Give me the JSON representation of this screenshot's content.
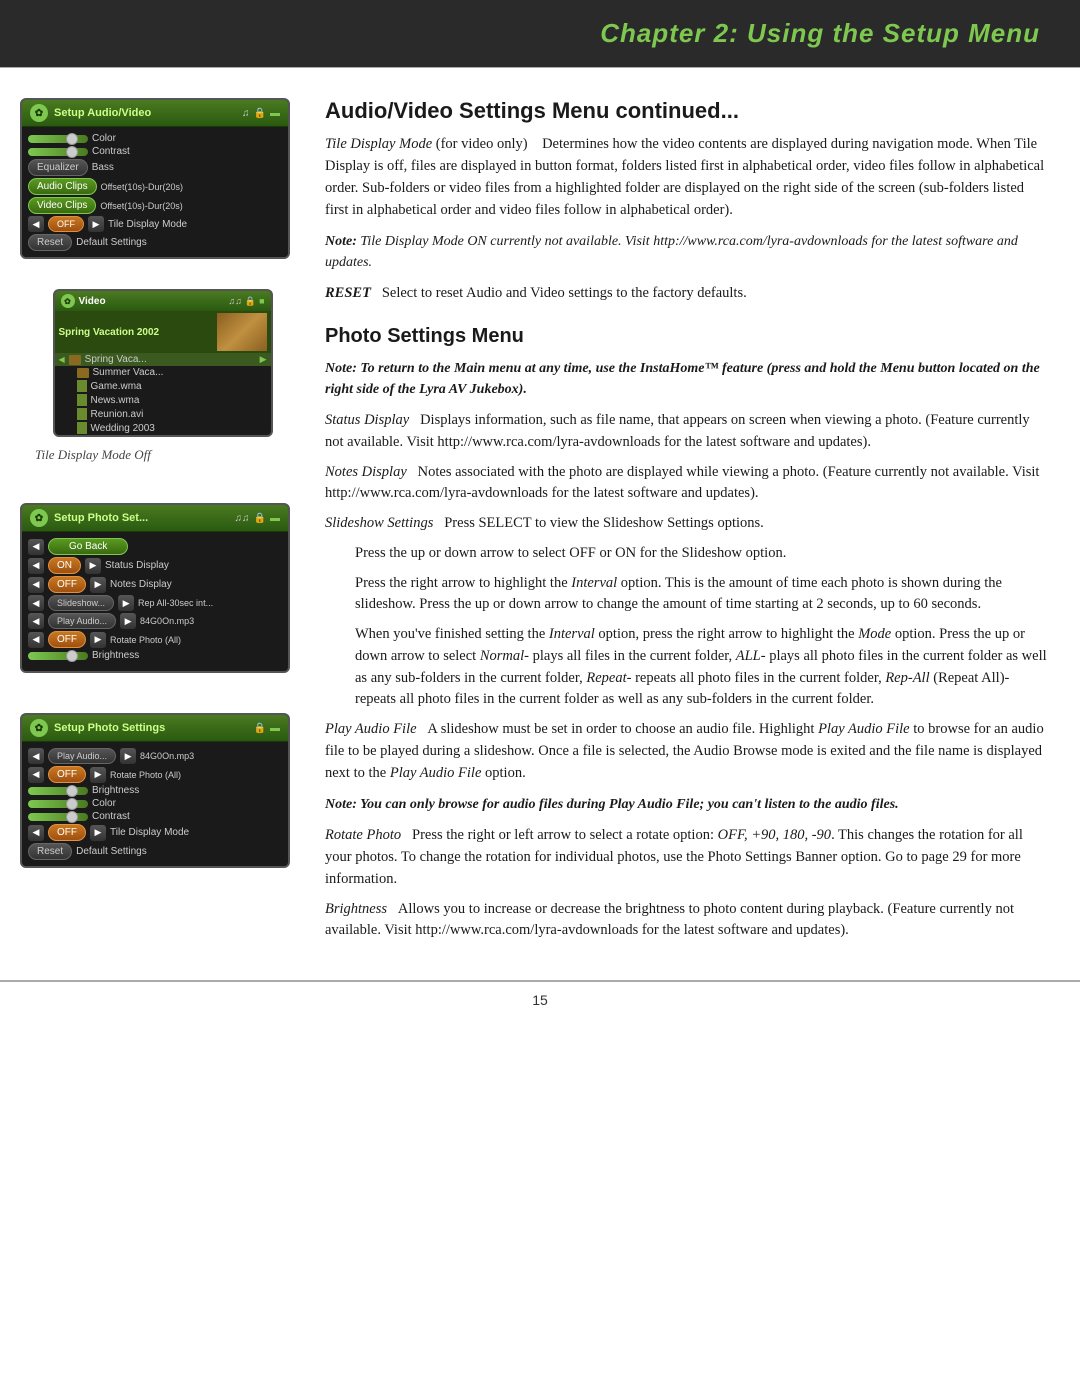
{
  "header": {
    "chapter": "Chapter 2: ",
    "title": "Using the Setup Menu"
  },
  "section1": {
    "title": "Audio/Video Settings Menu continued...",
    "intro": "Tile Display Mode (for video only)    Determines how the video contents are displayed during navigation mode. When Tile Display is off, files are displayed in button format, folders listed first in alphabetical order, video files follow in alphabetical order. Sub-folders or video files from a highlighted folder are displayed on the right side of the screen (sub-folders listed first in alphabetical order and video files follow in alphabetical order).",
    "note": "Note: Tile Display Mode ON currently not available. Visit http://www.rca.com/lyra-avdownloads for the latest software and updates.",
    "video_caption": "Tile Display Mode Off",
    "reset_text": "RESET    Select to reset Audio and Video settings to the factory defaults."
  },
  "section2": {
    "title": "Photo Settings Menu",
    "note1": "Note: To return to the Main menu at any time, use the InstaHome™ feature (press and hold the Menu button located on the right side of the Lyra AV Jukebox).",
    "status_display": "Status Display    Displays information, such as file name, that appears on screen when viewing a photo. (Feature currently not available. Visit http://www.rca.com/lyra-avdownloads for the latest software and updates).",
    "notes_display": "Notes Display    Notes associated with the photo are displayed while viewing a photo. (Feature currently not available. Visit http://www.rca.com/lyra-avdownloads for the latest software and updates).",
    "slideshow_settings_label": "Slideshow Settings",
    "slideshow_settings_text": "Press SELECT to view the Slideshow Settings options.",
    "slideshow_p1": "Press the up or down arrow to select OFF or ON for the Slideshow option.",
    "slideshow_p2": "Press the right arrow to highlight the Interval option. This is the amount of time each photo is shown during the slideshow. Press the up or down arrow to change the amount of time starting at 2 seconds, up to 60 seconds.",
    "slideshow_p3": "When you've finished setting the Interval option, press the right arrow to highlight the Mode option. Press the up or down arrow to select Normal- plays all files in the current folder, ALL- plays all photo files in the current folder as well as any sub-folders in the current folder, Repeat- repeats all photo files in the current folder, Rep-All (Repeat All)- repeats all photo files in the current folder as well as any sub-folders in the current folder.",
    "play_audio": "Play Audio File    A slideshow must be set in order to choose an audio file. Highlight Play Audio File to browse for an audio file to be played during a slideshow. Once a file is selected, the Audio Browse mode is exited and the file name is displayed next to the Play Audio File option.",
    "note2": "Note: You can only browse for audio files during Play Audio File; you can't listen to the audio files.",
    "rotate_photo": "Rotate Photo    Press the right or left arrow to select a rotate option: OFF, +90, 180, -90. This changes the rotation for all your photos. To change the rotation for individual photos, use the Photo Settings Banner option. Go to page 29 for more information.",
    "brightness": "Brightness    Allows you to increase or decrease the brightness to photo content during playback. (Feature currently not available. Visit http://www.rca.com/lyra-avdownloads for the latest software and updates)."
  },
  "device1": {
    "title": "Setup",
    "subtitle": "Audio/Video",
    "rows": [
      {
        "type": "slider",
        "label": "Color"
      },
      {
        "type": "slider",
        "label": "Contrast"
      },
      {
        "type": "labeled",
        "key": "Equalizer",
        "value": "Bass"
      },
      {
        "type": "labeled",
        "key": "Audio Clips",
        "value": "Offset(10s)-Dur(20s)"
      },
      {
        "type": "labeled",
        "key": "Video Clips",
        "value": "Offset(10s)-Dur(20s)"
      },
      {
        "type": "arrow-value",
        "value": "OFF",
        "label": "Tile Display Mode"
      },
      {
        "type": "labeled",
        "key": "Reset",
        "value": "Default Settings"
      }
    ]
  },
  "device2": {
    "title": "Setup",
    "subtitle": "Photo Set...",
    "rows": [
      {
        "type": "back",
        "label": "Go Back"
      },
      {
        "type": "arrow-value",
        "value": "ON",
        "label": "Status Display"
      },
      {
        "type": "arrow-value",
        "value": "OFF",
        "label": "Notes Display"
      },
      {
        "type": "arrow-value",
        "value": "Slideshow...",
        "label": "Rep All-30sec int..."
      },
      {
        "type": "arrow-value",
        "value": "Play Audio...",
        "label": "84G0On.mp3"
      },
      {
        "type": "arrow-value",
        "value": "OFF",
        "label": "Rotate Photo (All)"
      },
      {
        "type": "slider",
        "label": "Brightness"
      }
    ]
  },
  "device3": {
    "title": "Setup",
    "subtitle": "Photo Settings",
    "rows": [
      {
        "type": "back-file",
        "label": "Play Audio...",
        "value": "84G0On.mp3"
      },
      {
        "type": "arrow-value",
        "value": "OFF",
        "label": "Rotate Photo (All)"
      },
      {
        "type": "slider",
        "label": "Brightness"
      },
      {
        "type": "slider",
        "label": "Color"
      },
      {
        "type": "slider",
        "label": "Contrast"
      },
      {
        "type": "arrow-value",
        "value": "OFF",
        "label": "Tile Display Mode"
      },
      {
        "type": "labeled",
        "key": "Reset",
        "value": "Default Settings"
      }
    ]
  },
  "video_screen": {
    "title": "Video",
    "highlighted": "Spring Vacation 2002",
    "items": [
      {
        "name": "Spring Vaca...",
        "type": "folder",
        "arrow": true
      },
      {
        "name": "Summer Vaca...",
        "type": "folder"
      },
      {
        "name": "Game.wma",
        "type": "file"
      },
      {
        "name": "News.wma",
        "type": "file"
      },
      {
        "name": "Reunion.avi",
        "type": "file"
      },
      {
        "name": "Wedding 2003",
        "type": "file"
      }
    ]
  },
  "footer": {
    "page_number": "15"
  }
}
